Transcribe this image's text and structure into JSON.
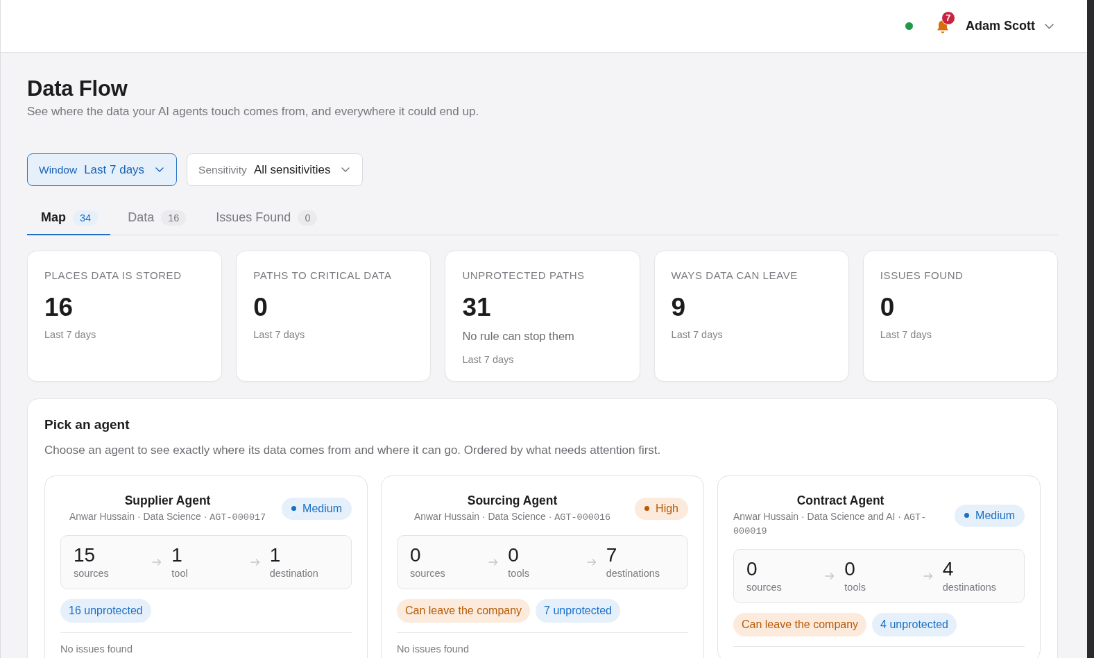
{
  "header": {
    "notification_count": "7",
    "user_name": "Adam Scott"
  },
  "page": {
    "title": "Data Flow",
    "subtitle": "See where the data your AI agents touch comes from, and everywhere it could end up."
  },
  "filters": [
    {
      "label": "Window",
      "value": "Last 7 days",
      "active": true
    },
    {
      "label": "Sensitivity",
      "value": "All sensitivities",
      "active": false
    }
  ],
  "tabs": [
    {
      "label": "Map",
      "count": "34",
      "selected": true
    },
    {
      "label": "Data",
      "count": "16",
      "selected": false
    },
    {
      "label": "Issues Found",
      "count": "0",
      "selected": false
    }
  ],
  "stats": [
    {
      "label": "PLACES DATA IS STORED",
      "value": "16",
      "note": "Last 7 days"
    },
    {
      "label": "PATHS TO CRITICAL DATA",
      "value": "0",
      "note": "Last 7 days"
    },
    {
      "label": "UNPROTECTED PATHS",
      "value": "31",
      "detail": "No rule can stop them",
      "note": "Last 7 days"
    },
    {
      "label": "WAYS DATA CAN LEAVE",
      "value": "9",
      "note": "Last 7 days"
    },
    {
      "label": "ISSUES FOUND",
      "value": "0",
      "note": "Last 7 days"
    }
  ],
  "agent_picker": {
    "title": "Pick an agent",
    "description": "Choose an agent to see exactly where its data comes from and where it can go. Ordered by what needs attention first.",
    "agents": [
      {
        "name": "Supplier Agent",
        "meta": "Anwar Hussain · Data Science ·",
        "agent_id": "AGT-000017",
        "risk": {
          "kind": "medium",
          "label": "Medium"
        },
        "flow": [
          {
            "count": "15",
            "label": "sources"
          },
          {
            "count": "1",
            "label": "tool"
          },
          {
            "count": "1",
            "label": "destination"
          }
        ],
        "tags": [
          {
            "kind": "unprotected",
            "label": "16 unprotected"
          }
        ],
        "issues": "No issues found"
      },
      {
        "name": "Sourcing Agent",
        "meta": "Anwar Hussain · Data Science ·",
        "agent_id": "AGT-000016",
        "risk": {
          "kind": "high",
          "label": "High"
        },
        "flow": [
          {
            "count": "0",
            "label": "sources"
          },
          {
            "count": "0",
            "label": "tools"
          },
          {
            "count": "7",
            "label": "destinations"
          }
        ],
        "tags": [
          {
            "kind": "exposure",
            "label": "Can leave the company"
          },
          {
            "kind": "unprotected",
            "label": "7 unprotected"
          }
        ],
        "issues": "No issues found"
      },
      {
        "name": "Contract Agent",
        "meta": "Anwar Hussain · Data Science and AI ·",
        "agent_id": "AGT-000019",
        "risk": {
          "kind": "medium",
          "label": "Medium"
        },
        "flow": [
          {
            "count": "0",
            "label": "sources"
          },
          {
            "count": "0",
            "label": "tools"
          },
          {
            "count": "4",
            "label": "destinations"
          }
        ],
        "tags": [
          {
            "kind": "exposure",
            "label": "Can leave the company"
          },
          {
            "kind": "unprotected",
            "label": "4 unprotected"
          }
        ]
      }
    ]
  }
}
